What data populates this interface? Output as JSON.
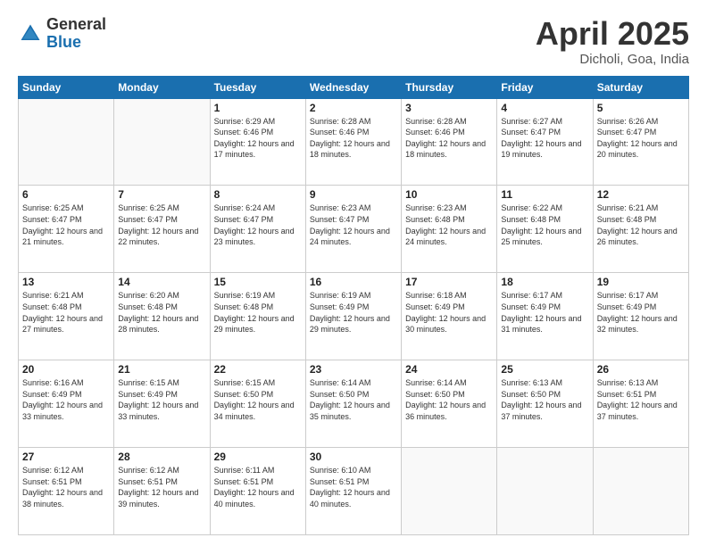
{
  "logo": {
    "general": "General",
    "blue": "Blue"
  },
  "title": {
    "month": "April 2025",
    "location": "Dicholi, Goa, India"
  },
  "headers": [
    "Sunday",
    "Monday",
    "Tuesday",
    "Wednesday",
    "Thursday",
    "Friday",
    "Saturday"
  ],
  "weeks": [
    [
      {
        "day": "",
        "sunrise": "",
        "sunset": "",
        "daylight": ""
      },
      {
        "day": "",
        "sunrise": "",
        "sunset": "",
        "daylight": ""
      },
      {
        "day": "1",
        "sunrise": "Sunrise: 6:29 AM",
        "sunset": "Sunset: 6:46 PM",
        "daylight": "Daylight: 12 hours and 17 minutes."
      },
      {
        "day": "2",
        "sunrise": "Sunrise: 6:28 AM",
        "sunset": "Sunset: 6:46 PM",
        "daylight": "Daylight: 12 hours and 18 minutes."
      },
      {
        "day": "3",
        "sunrise": "Sunrise: 6:28 AM",
        "sunset": "Sunset: 6:46 PM",
        "daylight": "Daylight: 12 hours and 18 minutes."
      },
      {
        "day": "4",
        "sunrise": "Sunrise: 6:27 AM",
        "sunset": "Sunset: 6:47 PM",
        "daylight": "Daylight: 12 hours and 19 minutes."
      },
      {
        "day": "5",
        "sunrise": "Sunrise: 6:26 AM",
        "sunset": "Sunset: 6:47 PM",
        "daylight": "Daylight: 12 hours and 20 minutes."
      }
    ],
    [
      {
        "day": "6",
        "sunrise": "Sunrise: 6:25 AM",
        "sunset": "Sunset: 6:47 PM",
        "daylight": "Daylight: 12 hours and 21 minutes."
      },
      {
        "day": "7",
        "sunrise": "Sunrise: 6:25 AM",
        "sunset": "Sunset: 6:47 PM",
        "daylight": "Daylight: 12 hours and 22 minutes."
      },
      {
        "day": "8",
        "sunrise": "Sunrise: 6:24 AM",
        "sunset": "Sunset: 6:47 PM",
        "daylight": "Daylight: 12 hours and 23 minutes."
      },
      {
        "day": "9",
        "sunrise": "Sunrise: 6:23 AM",
        "sunset": "Sunset: 6:47 PM",
        "daylight": "Daylight: 12 hours and 24 minutes."
      },
      {
        "day": "10",
        "sunrise": "Sunrise: 6:23 AM",
        "sunset": "Sunset: 6:48 PM",
        "daylight": "Daylight: 12 hours and 24 minutes."
      },
      {
        "day": "11",
        "sunrise": "Sunrise: 6:22 AM",
        "sunset": "Sunset: 6:48 PM",
        "daylight": "Daylight: 12 hours and 25 minutes."
      },
      {
        "day": "12",
        "sunrise": "Sunrise: 6:21 AM",
        "sunset": "Sunset: 6:48 PM",
        "daylight": "Daylight: 12 hours and 26 minutes."
      }
    ],
    [
      {
        "day": "13",
        "sunrise": "Sunrise: 6:21 AM",
        "sunset": "Sunset: 6:48 PM",
        "daylight": "Daylight: 12 hours and 27 minutes."
      },
      {
        "day": "14",
        "sunrise": "Sunrise: 6:20 AM",
        "sunset": "Sunset: 6:48 PM",
        "daylight": "Daylight: 12 hours and 28 minutes."
      },
      {
        "day": "15",
        "sunrise": "Sunrise: 6:19 AM",
        "sunset": "Sunset: 6:48 PM",
        "daylight": "Daylight: 12 hours and 29 minutes."
      },
      {
        "day": "16",
        "sunrise": "Sunrise: 6:19 AM",
        "sunset": "Sunset: 6:49 PM",
        "daylight": "Daylight: 12 hours and 29 minutes."
      },
      {
        "day": "17",
        "sunrise": "Sunrise: 6:18 AM",
        "sunset": "Sunset: 6:49 PM",
        "daylight": "Daylight: 12 hours and 30 minutes."
      },
      {
        "day": "18",
        "sunrise": "Sunrise: 6:17 AM",
        "sunset": "Sunset: 6:49 PM",
        "daylight": "Daylight: 12 hours and 31 minutes."
      },
      {
        "day": "19",
        "sunrise": "Sunrise: 6:17 AM",
        "sunset": "Sunset: 6:49 PM",
        "daylight": "Daylight: 12 hours and 32 minutes."
      }
    ],
    [
      {
        "day": "20",
        "sunrise": "Sunrise: 6:16 AM",
        "sunset": "Sunset: 6:49 PM",
        "daylight": "Daylight: 12 hours and 33 minutes."
      },
      {
        "day": "21",
        "sunrise": "Sunrise: 6:15 AM",
        "sunset": "Sunset: 6:49 PM",
        "daylight": "Daylight: 12 hours and 33 minutes."
      },
      {
        "day": "22",
        "sunrise": "Sunrise: 6:15 AM",
        "sunset": "Sunset: 6:50 PM",
        "daylight": "Daylight: 12 hours and 34 minutes."
      },
      {
        "day": "23",
        "sunrise": "Sunrise: 6:14 AM",
        "sunset": "Sunset: 6:50 PM",
        "daylight": "Daylight: 12 hours and 35 minutes."
      },
      {
        "day": "24",
        "sunrise": "Sunrise: 6:14 AM",
        "sunset": "Sunset: 6:50 PM",
        "daylight": "Daylight: 12 hours and 36 minutes."
      },
      {
        "day": "25",
        "sunrise": "Sunrise: 6:13 AM",
        "sunset": "Sunset: 6:50 PM",
        "daylight": "Daylight: 12 hours and 37 minutes."
      },
      {
        "day": "26",
        "sunrise": "Sunrise: 6:13 AM",
        "sunset": "Sunset: 6:51 PM",
        "daylight": "Daylight: 12 hours and 37 minutes."
      }
    ],
    [
      {
        "day": "27",
        "sunrise": "Sunrise: 6:12 AM",
        "sunset": "Sunset: 6:51 PM",
        "daylight": "Daylight: 12 hours and 38 minutes."
      },
      {
        "day": "28",
        "sunrise": "Sunrise: 6:12 AM",
        "sunset": "Sunset: 6:51 PM",
        "daylight": "Daylight: 12 hours and 39 minutes."
      },
      {
        "day": "29",
        "sunrise": "Sunrise: 6:11 AM",
        "sunset": "Sunset: 6:51 PM",
        "daylight": "Daylight: 12 hours and 40 minutes."
      },
      {
        "day": "30",
        "sunrise": "Sunrise: 6:10 AM",
        "sunset": "Sunset: 6:51 PM",
        "daylight": "Daylight: 12 hours and 40 minutes."
      },
      {
        "day": "",
        "sunrise": "",
        "sunset": "",
        "daylight": ""
      },
      {
        "day": "",
        "sunrise": "",
        "sunset": "",
        "daylight": ""
      },
      {
        "day": "",
        "sunrise": "",
        "sunset": "",
        "daylight": ""
      }
    ]
  ]
}
